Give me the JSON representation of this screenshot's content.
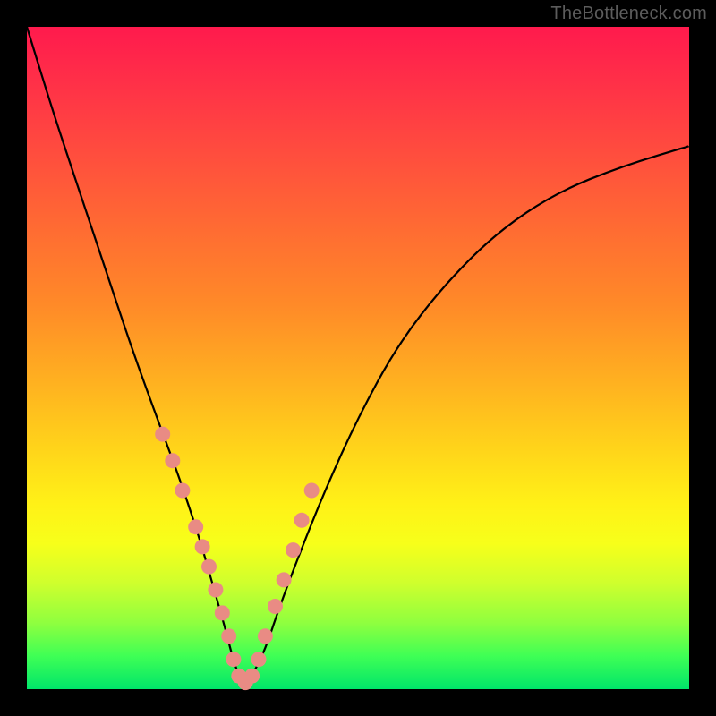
{
  "watermark": "TheBottleneck.com",
  "chart_data": {
    "type": "line",
    "title": "",
    "xlabel": "",
    "ylabel": "",
    "xlim": [
      0,
      100
    ],
    "ylim": [
      0,
      100
    ],
    "grid": false,
    "legend": false,
    "background": "rainbow-vertical",
    "series": [
      {
        "name": "bottleneck-curve",
        "x": [
          0,
          4,
          8,
          12,
          16,
          20,
          23,
          26,
          28,
          30,
          31,
          32,
          33,
          34,
          36,
          38,
          41,
          45,
          50,
          56,
          63,
          71,
          80,
          90,
          100
        ],
        "y": [
          100,
          87,
          75,
          63,
          51,
          40,
          32,
          23,
          16,
          9,
          5,
          2,
          1,
          2,
          6,
          12,
          20,
          30,
          41,
          52,
          61,
          69,
          75,
          79,
          82
        ]
      }
    ],
    "markers": {
      "name": "highlight-dots",
      "color": "#e98b84",
      "x": [
        20.5,
        22.0,
        23.5,
        25.5,
        26.5,
        27.5,
        28.5,
        29.5,
        30.5,
        31.2,
        32.0,
        33.0,
        34.0,
        35.0,
        36.0,
        37.5,
        38.8,
        40.2,
        41.5,
        43.0
      ],
      "y": [
        38.5,
        34.5,
        30.0,
        24.5,
        21.5,
        18.5,
        15.0,
        11.5,
        8.0,
        4.5,
        2.0,
        1.0,
        2.0,
        4.5,
        8.0,
        12.5,
        16.5,
        21.0,
        25.5,
        30.0
      ]
    }
  }
}
